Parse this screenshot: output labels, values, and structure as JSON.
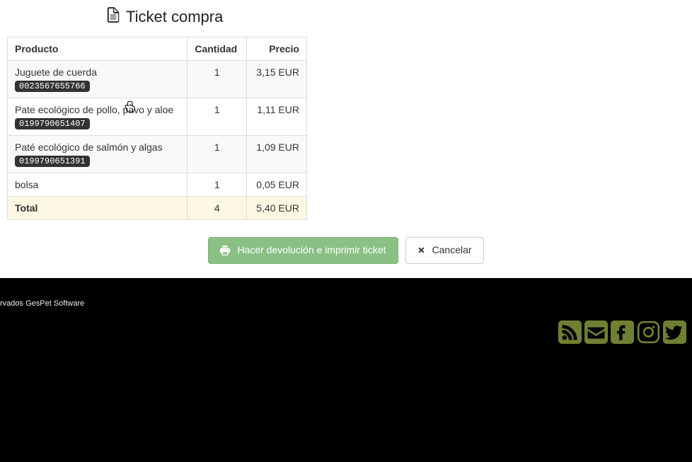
{
  "title": "Ticket compra",
  "columns": {
    "product": "Producto",
    "quantity": "Cantidad",
    "price": "Precio"
  },
  "items": [
    {
      "name": "Juguete de cuerda",
      "code": "0023567655766",
      "qty": "1",
      "price": "3,15 EUR"
    },
    {
      "name": "Pate ecológico de pollo, pavo y aloe",
      "code": "0199790651407",
      "qty": "1",
      "price": "1,11 EUR"
    },
    {
      "name": "Paté ecológico de salmón y algas",
      "code": "0199790651391",
      "qty": "1",
      "price": "1,09 EUR"
    },
    {
      "name": "bolsa",
      "code": "",
      "qty": "1",
      "price": "0,05 EUR"
    }
  ],
  "total": {
    "label": "Total",
    "qty": "4",
    "price": "5,40 EUR"
  },
  "actions": {
    "return_print": "Hacer devolución e imprimir ticket",
    "cancel": "Cancelar"
  },
  "footer": {
    "copy": "rvados GesPet Software"
  }
}
